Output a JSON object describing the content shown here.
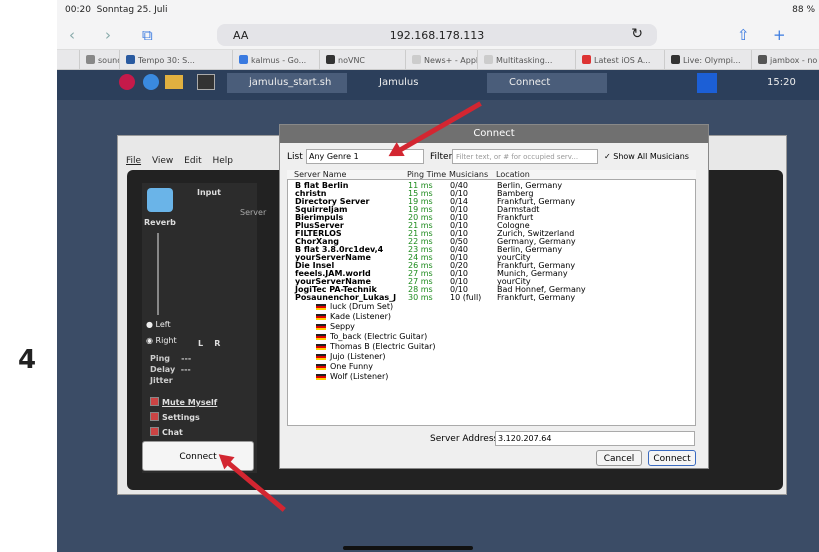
{
  "status": {
    "time": "00:20",
    "date": "Sonntag 25. Juli",
    "right": "88 %"
  },
  "browser": {
    "aa": "AA",
    "url": "192.168.178.113",
    "reload": "↻"
  },
  "tabs": [
    {
      "label": "sound,",
      "color": "#888"
    },
    {
      "label": "Tempo 30: S...",
      "color": "#2a5aa0"
    },
    {
      "label": "kalmus - Go...",
      "color": "#3a7ae0"
    },
    {
      "label": "noVNC",
      "color": "#333"
    },
    {
      "label": "News+ - Apple",
      "color": "#ccc"
    },
    {
      "label": "Multitasking...",
      "color": "#ccc"
    },
    {
      "label": "Latest iOS A...",
      "color": "#d33"
    },
    {
      "label": "Live: Olympi...",
      "color": "#333"
    },
    {
      "label": "jambox - no",
      "color": "#555"
    }
  ],
  "panel": {
    "term": "jamulus_start.sh",
    "jamulus": "Jamulus",
    "connect": "Connect",
    "clock": "15:20"
  },
  "menu": {
    "file": "File",
    "view": "View",
    "edit": "Edit",
    "help": "Help"
  },
  "jamulus": {
    "input": "Input",
    "reverb": "Reverb",
    "left": "Left",
    "right": "Right",
    "l": "L",
    "r": "R",
    "server": "Server",
    "ping": "Ping",
    "delay": "Delay",
    "jitter": "Jitter",
    "dash": "---",
    "mute": "Mute Myself",
    "settings": "Settings",
    "chat": "Chat",
    "connect": "Connect"
  },
  "dialog": {
    "title": "Connect",
    "list_label": "List",
    "list_value": "Any Genre 1",
    "filter_label": "Filter",
    "filter_placeholder": "Filter text, or # for occupied serv...",
    "show_all": "Show All Musicians",
    "check": "✓",
    "headers": [
      "Server Name",
      "Ping Time",
      "Musicians",
      "Location"
    ],
    "servers": [
      [
        "B flat Berlin",
        "11 ms",
        "0/40",
        "Berlin, Germany"
      ],
      [
        "christn",
        "15 ms",
        "0/10",
        "Bamberg"
      ],
      [
        "Directory Server",
        "19 ms",
        "0/14",
        "Frankfurt, Germany"
      ],
      [
        "Squirreljam",
        "19 ms",
        "0/10",
        "Darmstadt"
      ],
      [
        "Bierimpuls",
        "20 ms",
        "0/10",
        "Frankfurt"
      ],
      [
        "PlusServer",
        "21 ms",
        "0/10",
        "Cologne"
      ],
      [
        "FILTERLOS",
        "21 ms",
        "0/10",
        "Zurich, Switzerland"
      ],
      [
        "ChorXang",
        "22 ms",
        "0/50",
        "Germany, Germany"
      ],
      [
        "B flat 3.8.0rc1dev,4",
        "23 ms",
        "0/40",
        "Berlin, Germany"
      ],
      [
        "yourServerName",
        "24 ms",
        "0/10",
        "yourCity"
      ],
      [
        "Die Insel",
        "26 ms",
        "0/20",
        "Frankfurt, Germany"
      ],
      [
        "feeels.JAM.world",
        "27 ms",
        "0/10",
        "Munich, Germany"
      ],
      [
        "yourServerName",
        "27 ms",
        "0/10",
        "yourCity"
      ],
      [
        "JogiTec PA-Technik",
        "28 ms",
        "0/10",
        "Bad Honnef, Germany"
      ],
      [
        "Posaunenchor_Lukas_J",
        "30 ms",
        "10 (full)",
        "Frankfurt, Germany"
      ]
    ],
    "musicians": [
      "luck (Drum Set)",
      "Kade (Listener)",
      "Seppy",
      "To_back (Electric Guitar)",
      "Thomas B (Electric Guitar)",
      "Jujo (Listener)",
      "One Funny",
      "Wolf (Listener)"
    ],
    "server_address_label": "Server Address",
    "server_address": "3.120.207.64",
    "cancel": "Cancel",
    "connect": "Connect"
  },
  "step": "4"
}
